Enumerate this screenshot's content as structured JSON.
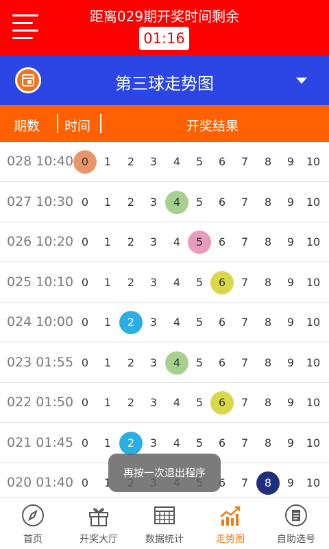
{
  "header": {
    "countdown_label": "距离029期开奖时间剩余",
    "countdown_time": "01:16",
    "accent_color": "#fe0000"
  },
  "title_bar": {
    "title": "第三球走势图",
    "icon": "document-icon",
    "dropdown_icon": "triangle-down-icon",
    "color": "#2b46e5"
  },
  "table_header": {
    "issue": "期数",
    "time": "时间",
    "result": "开奖结果",
    "color": "#fe6002"
  },
  "numbers": [
    "0",
    "1",
    "2",
    "3",
    "4",
    "5",
    "6",
    "7",
    "8",
    "9",
    "10"
  ],
  "rows": [
    {
      "label": "028 10:40",
      "highlight": 0,
      "color": "#e8956a"
    },
    {
      "label": "027 10:30",
      "highlight": 4,
      "color": "#a5d08e"
    },
    {
      "label": "026 10:20",
      "highlight": 5,
      "color": "#e79cbe"
    },
    {
      "label": "025 10:10",
      "highlight": 6,
      "color": "#d9d84a"
    },
    {
      "label": "024 10:00",
      "highlight": 2,
      "color": "#2aaee3"
    },
    {
      "label": "023 01:55",
      "highlight": 4,
      "color": "#a5d08e"
    },
    {
      "label": "022 01:50",
      "highlight": 6,
      "color": "#d9d84a"
    },
    {
      "label": "021 01:45",
      "highlight": 2,
      "color": "#2aaee3"
    },
    {
      "label": "020 01:40",
      "highlight": 8,
      "color": "#1e2f7d"
    }
  ],
  "toast": "再按一次退出程序",
  "bottom_nav": [
    {
      "label": "首页",
      "icon": "compass-icon",
      "active": false
    },
    {
      "label": "开奖大厅",
      "icon": "gift-icon",
      "active": false
    },
    {
      "label": "数据统计",
      "icon": "table-icon",
      "active": false
    },
    {
      "label": "走势图",
      "icon": "trend-chart-icon",
      "active": true
    },
    {
      "label": "自助选号",
      "icon": "document-icon",
      "active": false
    }
  ],
  "active_color": "#f07b16"
}
